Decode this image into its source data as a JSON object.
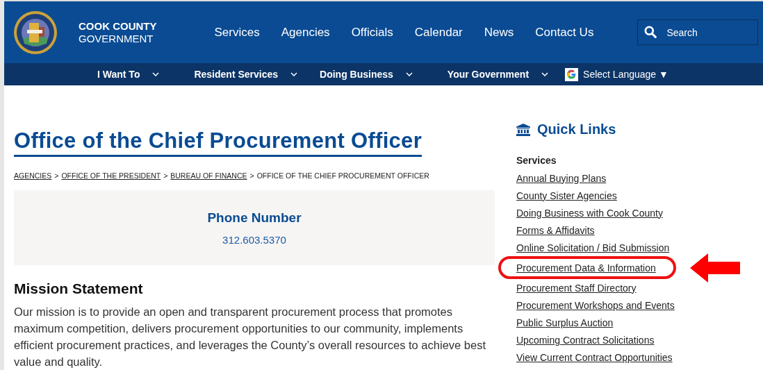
{
  "header": {
    "brand_line_1": "COOK COUNTY",
    "brand_line_2": "GOVERNMENT",
    "nav": [
      "Services",
      "Agencies",
      "Officials",
      "Calendar",
      "News",
      "Contact Us"
    ],
    "search": {
      "placeholder": "Search"
    }
  },
  "subnav": {
    "items": [
      "I Want To",
      "Resident Services",
      "Doing Business",
      "Your Government"
    ],
    "language": "Select Language",
    "language_caret": "▼"
  },
  "page": {
    "title": "Office of the Chief Procurement Officer",
    "breadcrumb": [
      {
        "label": "AGENCIES",
        "link": true
      },
      {
        "label": "OFFICE OF THE PRESIDENT",
        "link": true
      },
      {
        "label": "BUREAU OF FINANCE",
        "link": true
      },
      {
        "label": "OFFICE OF THE CHIEF PROCUREMENT OFFICER",
        "link": false
      }
    ],
    "breadcrumb_separator": ">",
    "phone": {
      "heading": "Phone Number",
      "number": "312.603.5370"
    },
    "mission": {
      "heading": "Mission Statement",
      "text": "Our mission is to provide an open and transparent procurement process that promotes maximum competition, delivers procurement opportunities to our community, implements efficient procurement practices, and leverages the County’s overall resources to achieve best value and quality."
    }
  },
  "quick_links": {
    "title": "Quick Links",
    "section": "Services",
    "links": [
      {
        "label": "Annual Buying Plans",
        "highlighted": false
      },
      {
        "label": "County Sister Agencies",
        "highlighted": false
      },
      {
        "label": "Doing Business with Cook County",
        "highlighted": false
      },
      {
        "label": "Forms & Affidavits",
        "highlighted": false
      },
      {
        "label": "Online Solicitation / Bid Submission",
        "highlighted": false
      },
      {
        "label": "Procurement Data & Information",
        "highlighted": true
      },
      {
        "label": "Procurement Staff Directory",
        "highlighted": false
      },
      {
        "label": "Procurement Workshops and Events",
        "highlighted": false
      },
      {
        "label": "Public Surplus Auction",
        "highlighted": false
      },
      {
        "label": "Upcoming Contract Solicitations",
        "highlighted": false
      },
      {
        "label": "View Current Contract Opportunities",
        "highlighted": false
      }
    ]
  }
}
